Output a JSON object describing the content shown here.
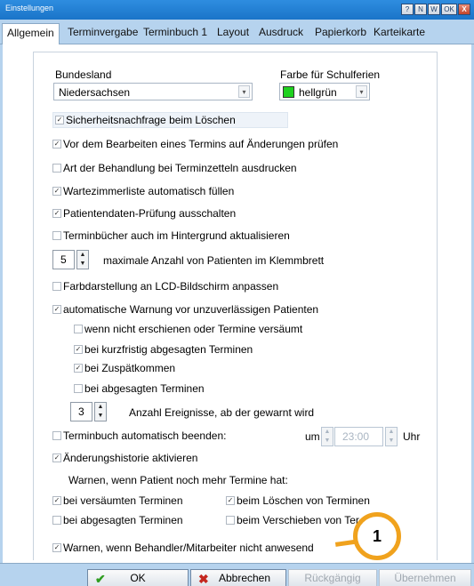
{
  "window": {
    "title": "Einstellungen"
  },
  "titlebar_buttons": [
    "?",
    "N",
    "W",
    "OK",
    "X"
  ],
  "tabs": [
    "Allgemein",
    "Terminvergabe",
    "Terminbuch 1",
    "Layout",
    "Ausdruck",
    "Papierkorb",
    "Karteikarte"
  ],
  "bundesland": {
    "label": "Bundesland",
    "value": "Niedersachsen"
  },
  "farbe": {
    "label": "Farbe für Schulferien",
    "value": "hellgrün",
    "color": "#1fd11f"
  },
  "options": [
    {
      "text": "Sicherheitsnachfrage beim Löschen",
      "checked": true
    },
    {
      "text": "Vor dem Bearbeiten eines Termins auf Änderungen prüfen",
      "checked": true
    },
    {
      "text": "Art der Behandlung bei Terminzetteln ausdrucken",
      "checked": false
    },
    {
      "text": "Wartezimmerliste automatisch füllen",
      "checked": true
    },
    {
      "text": "Patientendaten-Prüfung ausschalten",
      "checked": true
    },
    {
      "text": "Terminbücher auch im Hintergrund aktualisieren",
      "checked": false
    }
  ],
  "klemmbrett": {
    "value": "5",
    "label": "maximale Anzahl von Patienten im Klemmbrett"
  },
  "lcd": {
    "text": "Farbdarstellung an LCD-Bildschirm anpassen",
    "checked": false
  },
  "warnung": {
    "text": "automatische Warnung vor unzuverlässigen Patienten",
    "checked": true
  },
  "warn_sub": [
    {
      "text": "wenn nicht erschienen oder Termine versäumt",
      "checked": false
    },
    {
      "text": "bei kurzfristig abgesagten Terminen",
      "checked": true
    },
    {
      "text": "bei Zuspätkommen",
      "checked": true
    },
    {
      "text": "bei abgesagten Terminen",
      "checked": false
    }
  ],
  "ereignisse": {
    "value": "3",
    "label": "Anzahl Ereignisse, ab der gewarnt wird"
  },
  "terminbuch_beenden": {
    "text": "Terminbuch automatisch beenden:",
    "checked": false,
    "um": "um",
    "time": "23:00",
    "uhr": "Uhr"
  },
  "historie": {
    "text": "Änderungshistorie aktivieren",
    "checked": true
  },
  "warnen_heading": "Warnen, wenn Patient noch mehr Termine hat:",
  "warnen_opts": [
    {
      "text": "bei versäumten Terminen",
      "checked": true
    },
    {
      "text": "beim Löschen von Terminen",
      "checked": true
    },
    {
      "text": "bei abgesagten Terminen",
      "checked": false
    },
    {
      "text": "beim Verschieben von Ter",
      "checked": false
    }
  ],
  "behandler": {
    "text": "Warnen, wenn Behandler/Mitarbeiter nicht anwesend",
    "checked": true
  },
  "buttons": {
    "ok": "OK",
    "cancel": "Abbrechen",
    "undo": "Rückgängig",
    "apply": "Übernehmen"
  },
  "callout": "1",
  "check_glyph": "✓"
}
